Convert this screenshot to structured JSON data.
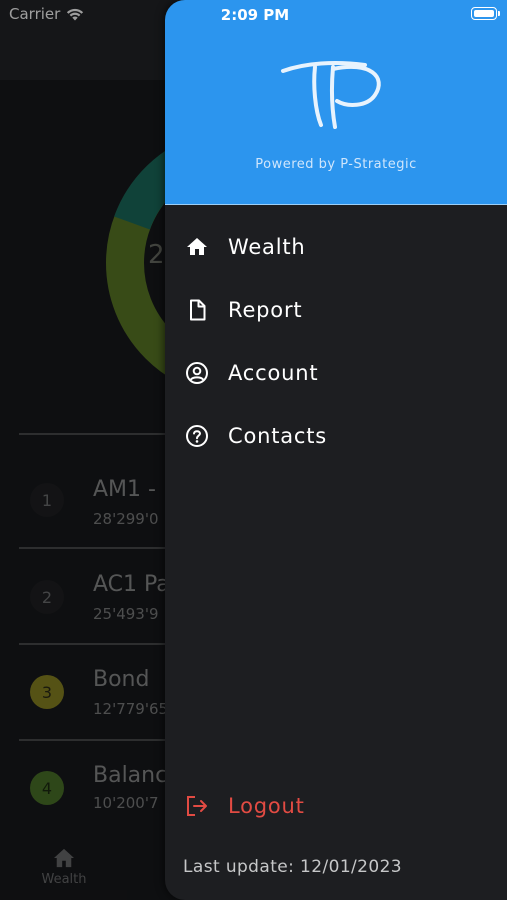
{
  "status_bar": {
    "carrier": "Carrier",
    "time": "2:09 PM"
  },
  "background": {
    "donut_center_text": "2",
    "donut_colors": [
      "#1a6b5c",
      "#5b7a26"
    ],
    "rows": [
      {
        "badge": "1",
        "title": "AM1 -",
        "subtitle": "28'299'0",
        "badge_color": "#1f2022"
      },
      {
        "badge": "2",
        "title": "AC1 Pa",
        "subtitle": "25'493'9",
        "badge_color": "#1f2022"
      },
      {
        "badge": "3",
        "title": "Bond",
        "subtitle": "12'779'65",
        "badge_color": "#a8a22a"
      },
      {
        "badge": "4",
        "title": "Balanc",
        "subtitle": "10'200'7",
        "badge_color": "#5a8a30"
      }
    ],
    "tab_label": "Wealth"
  },
  "drawer": {
    "logo_text": "TP",
    "powered_by": "Powered by P-Strategic",
    "header_color": "#2c95ee",
    "menu": [
      {
        "label": "Wealth",
        "icon": "home-icon"
      },
      {
        "label": "Report",
        "icon": "document-icon"
      },
      {
        "label": "Account",
        "icon": "account-circle-icon"
      },
      {
        "label": "Contacts",
        "icon": "help-circle-icon"
      }
    ],
    "logout_label": "Logout",
    "logout_color": "#e24b43",
    "last_update": "Last update: 12/01/2023"
  }
}
